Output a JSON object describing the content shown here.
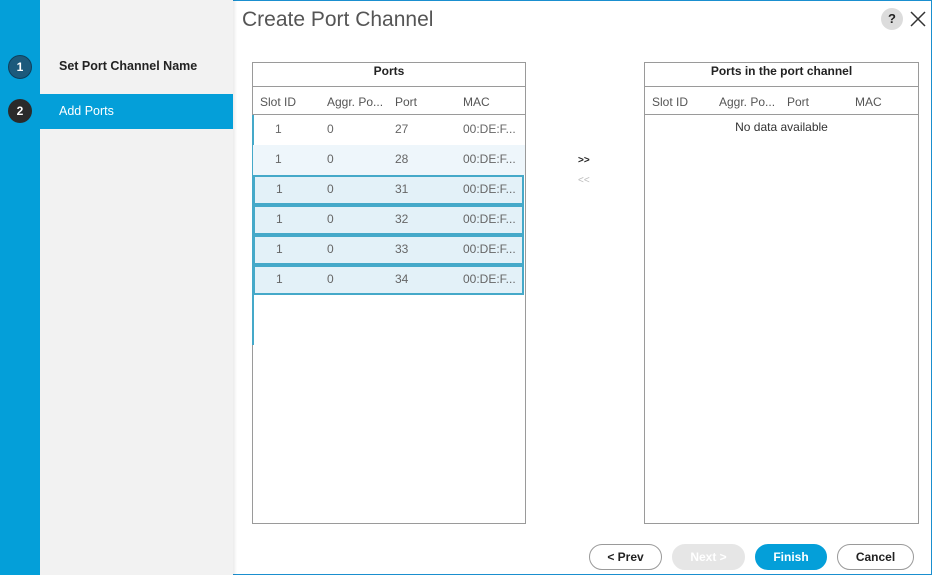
{
  "dialog": {
    "title": "Create Port Channel",
    "help_label": "?",
    "accent_color": "#049fd9"
  },
  "steps": [
    {
      "number": "1",
      "label": "Set Port Channel Name"
    },
    {
      "number": "2",
      "label": "Add Ports"
    }
  ],
  "ports_grid": {
    "title": "Ports",
    "columns": [
      "Slot ID",
      "Aggr. Po...",
      "Port",
      "MAC"
    ],
    "rows": [
      {
        "slot": "1",
        "aggr": "0",
        "port": "27",
        "mac": "00:DE:F..."
      },
      {
        "slot": "1",
        "aggr": "0",
        "port": "28",
        "mac": "00:DE:F..."
      },
      {
        "slot": "1",
        "aggr": "0",
        "port": "31",
        "mac": "00:DE:F..."
      },
      {
        "slot": "1",
        "aggr": "0",
        "port": "32",
        "mac": "00:DE:F..."
      },
      {
        "slot": "1",
        "aggr": "0",
        "port": "33",
        "mac": "00:DE:F..."
      },
      {
        "slot": "1",
        "aggr": "0",
        "port": "34",
        "mac": "00:DE:F..."
      }
    ]
  },
  "channel_grid": {
    "title": "Ports in the port channel",
    "columns": [
      "Slot ID",
      "Aggr. Po...",
      "Port",
      "MAC"
    ],
    "empty_text": "No data available"
  },
  "transfer": {
    "add_label": ">>",
    "remove_label": "<<"
  },
  "buttons": {
    "prev": "< Prev",
    "next": "Next >",
    "finish": "Finish",
    "cancel": "Cancel"
  }
}
